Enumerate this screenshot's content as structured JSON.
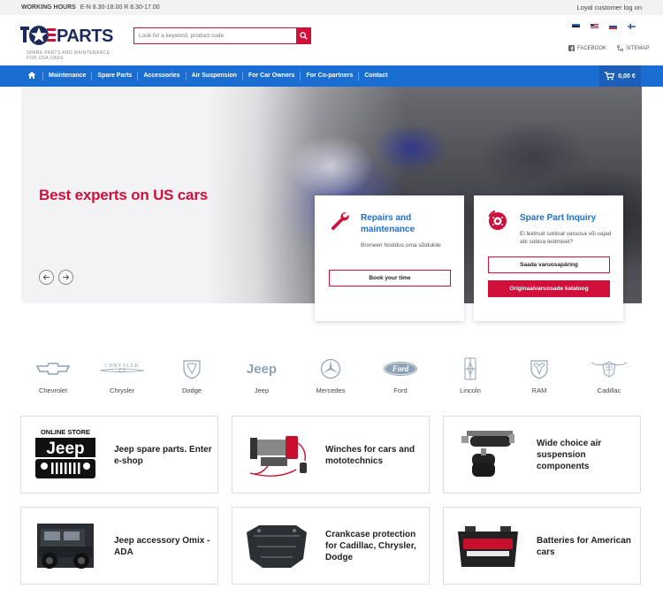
{
  "topbar": {
    "hours_label": "WORKING HOURS",
    "hours_value": "E-N 8.30-18.00 R 8.30-17.00",
    "loyal_link": "Loyal customer log on"
  },
  "logo": {
    "text": "PARTS",
    "tagline": "SPARE PARTS AND MAINTENANCE FOR USA CARS"
  },
  "search": {
    "placeholder": "Look for a keyword, product code"
  },
  "header_links": {
    "facebook": "FACEBOOK",
    "sitemap": "SITEMAP"
  },
  "nav": {
    "items": [
      "Maintenance",
      "Spare Parts",
      "Accessories",
      "Air Suspension",
      "For Car Owners",
      "For Co-partners",
      "Contact"
    ],
    "cart_total": "0,00 €"
  },
  "hero": {
    "headline": "Best experts on US cars"
  },
  "cards": {
    "repairs": {
      "title": "Repairs and maintenance",
      "text": "Broneeri hooldus oma sõidukile",
      "button": "Book your time"
    },
    "inquiry": {
      "title": "Spare Part Inquiry",
      "text": "Ei leidnud sobivat varuosa või vajad abi sobiva leidmisel?",
      "button_outline": "Saada varuosapäring",
      "button_filled": "Originaalvaruosade kataloog"
    }
  },
  "brands": [
    "Chevrolet",
    "Chrysler",
    "Dodge",
    "Jeep",
    "Mercedes",
    "Ford",
    "Lincoln",
    "RAM",
    "Cadillac"
  ],
  "brand_logo_text": {
    "chrysler": "CHRYSLER",
    "jeep": "Jeep",
    "ford": "Ford"
  },
  "tiles": [
    {
      "label": "Jeep spare parts. Enter e-shop",
      "image_caption": "ONLINE STORE",
      "image_logo": "Jeep"
    },
    {
      "label": "Winches for cars and mototechnics"
    },
    {
      "label": "Wide choice air suspension components"
    },
    {
      "label": "Jeep accessory Omix - ADA"
    },
    {
      "label": "Crankcase protection for Cadillac, Chrysler, Dodge"
    },
    {
      "label": "Batteries for American cars"
    }
  ],
  "colors": {
    "brand_red": "#d0103a",
    "nav_blue": "#1a6ed2",
    "logo_navy": "#1b2a5c"
  }
}
